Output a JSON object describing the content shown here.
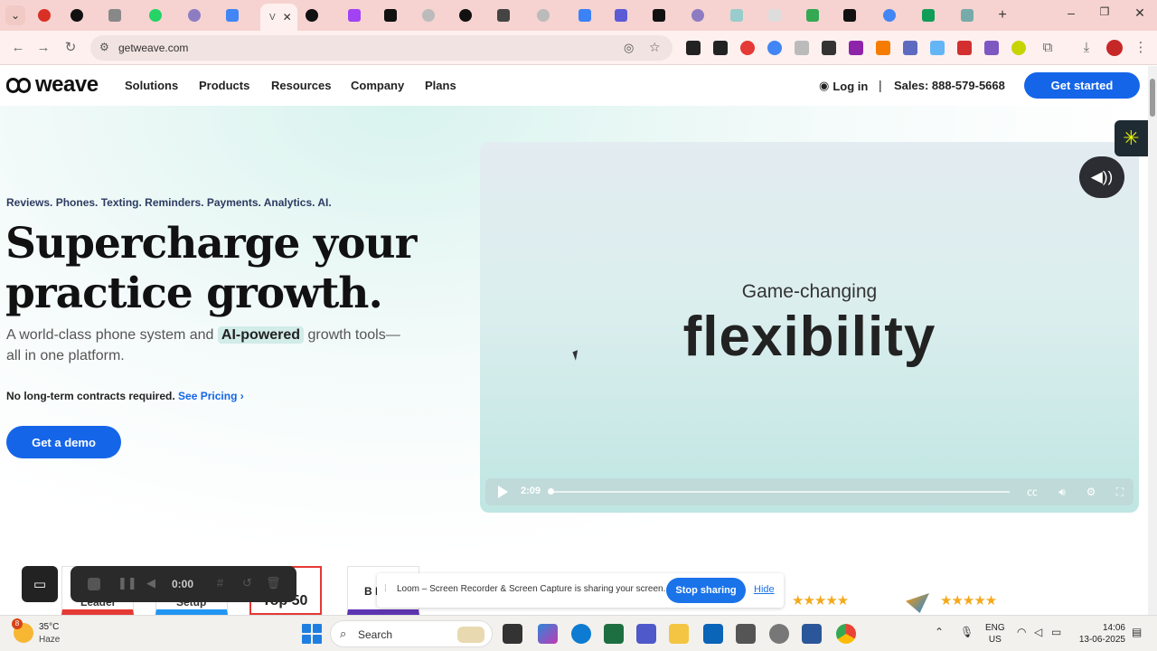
{
  "browser": {
    "url": "getweave.com",
    "active_tab_title": "V"
  },
  "site": {
    "logo_text": "weave",
    "nav": [
      "Solutions",
      "Products",
      "Resources",
      "Company",
      "Plans"
    ],
    "login_label": "Log in",
    "separator": "|",
    "sales_label": "Sales: 888-579-5668",
    "cta_label": "Get started"
  },
  "hero": {
    "tagline": "Reviews. Phones. Texting. Reminders. Payments. Analytics. AI.",
    "title": "Supercharge your practice growth.",
    "sub_before": "A world-class phone system and ",
    "sub_highlight": "AI-powered",
    "sub_after": " growth tools—all in one platform.",
    "contracts_text": "No long-term contracts required. ",
    "pricing_link": "See Pricing",
    "pricing_chevron": "›",
    "demo_label": "Get a demo"
  },
  "video": {
    "kicker": "Game-changing",
    "headline": "flexibility",
    "duration": "2:09",
    "progress": 0.0
  },
  "recorder": {
    "time": "0:00"
  },
  "loom": {
    "message": "Loom – Screen Recorder & Screen Capture is sharing your screen.",
    "stop_label": "Stop sharing",
    "hide_label": "Hide"
  },
  "badges": {
    "labels": [
      "Leader",
      "Setup",
      "Top 50",
      "B Res"
    ]
  },
  "ratings": {
    "stars": "★★★★★"
  },
  "taskbar": {
    "temperature": "35°C",
    "condition": "Haze",
    "search_placeholder": "Search",
    "lang_top": "ENG",
    "lang_bottom": "US",
    "time": "14:06",
    "date": "13-06-2025",
    "weather_badge": "8"
  },
  "colors": {
    "brand_blue": "#1565e8",
    "tabstrip": "#f6d3d0"
  }
}
